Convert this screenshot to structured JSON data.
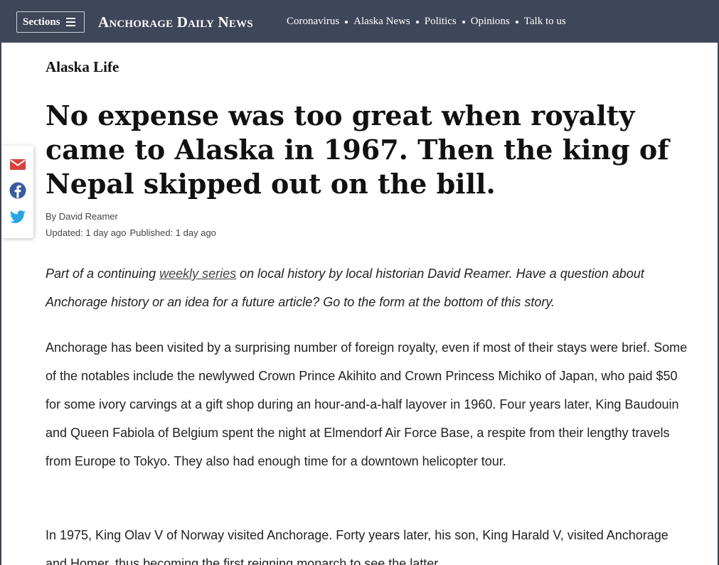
{
  "header": {
    "sections_label": "Sections",
    "logo": "Anchorage Daily News",
    "nav": [
      "Coronavirus",
      "Alaska News",
      "Politics",
      "Opinions",
      "Talk to us"
    ],
    "background_color": "#3e4759"
  },
  "share": {
    "icons": [
      "email-icon",
      "facebook-icon",
      "twitter-icon"
    ],
    "email_color": "#d9413d",
    "facebook_color": "#3b5c9a",
    "twitter_color": "#27a5e5"
  },
  "article": {
    "section": "Alaska Life",
    "headline": "No expense was too great when royalty came to Alaska in 1967. Then the king of Nepal skipped out on the bill.",
    "byline": "By David Reamer",
    "updated": "Updated: 1 day ago",
    "published": "Published: 1 day ago",
    "intro_before": "Part of a continuing ",
    "intro_link": "weekly series",
    "intro_after": " on local history by local historian David Reamer. Have a question about Anchorage history or an idea for a future article? Go to the form at the bottom of this story.",
    "paragraphs": [
      "Anchorage has been visited by a surprising number of foreign royalty, even if most of their stays were brief. Some of the notables include the newlywed Crown Prince Akihito and Crown Princess Michiko of Japan, who paid $50 for some ivory carvings at a gift shop during an hour-and-a-half layover in 1960. Four years later, King Baudouin and Queen Fabiola of Belgium spent the night at Elmendorf Air Force Base, a respite from their lengthy travels from Europe to Tokyo. They also had enough time for a downtown helicopter tour.",
      "In 1975, King Olav V of Norway visited Anchorage. Forty years later, his son, King Harald V, visited Anchorage and Homer, thus becoming the first reigning monarch to see the latter."
    ]
  }
}
